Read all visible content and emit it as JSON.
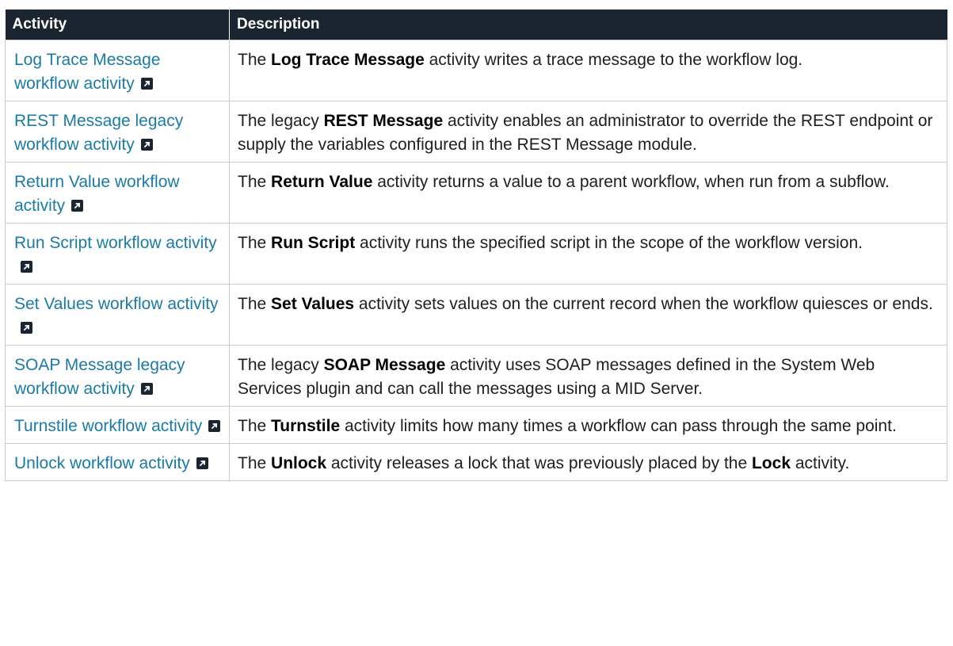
{
  "table": {
    "headers": {
      "activity": "Activity",
      "description": "Description"
    },
    "rows": [
      {
        "link": "Log Trace Message workflow activity",
        "icon": "external-link-icon",
        "desc": [
          {
            "t": "The "
          },
          {
            "b": "Log Trace Message"
          },
          {
            "t": " activity writes a trace message to the workflow log."
          }
        ]
      },
      {
        "link": "REST Message legacy workflow activity",
        "icon": "external-link-icon",
        "desc": [
          {
            "t": "The legacy "
          },
          {
            "b": "REST Message"
          },
          {
            "t": " activity enables an administrator to override the REST endpoint or supply the variables configured in the REST Message module."
          }
        ]
      },
      {
        "link": "Return Value workflow activity",
        "icon": "external-link-icon",
        "desc": [
          {
            "t": "The "
          },
          {
            "b": "Return Value"
          },
          {
            "t": " activity returns a value to a parent workflow, when run from a subflow."
          }
        ]
      },
      {
        "link": "Run Script workflow activity",
        "icon": "external-link-icon",
        "desc": [
          {
            "t": "The "
          },
          {
            "b": "Run Script"
          },
          {
            "t": " activity runs the specified script in the scope of the workflow version."
          }
        ]
      },
      {
        "link": "Set Values workflow activity",
        "icon": "external-link-icon",
        "desc": [
          {
            "t": "The "
          },
          {
            "b": "Set Values"
          },
          {
            "t": " activity sets values on the current record when the workflow quiesces or ends."
          }
        ]
      },
      {
        "link": "SOAP Message legacy workflow activity",
        "icon": "external-link-icon",
        "desc": [
          {
            "t": "The legacy "
          },
          {
            "b": "SOAP Message"
          },
          {
            "t": " activity uses SOAP messages defined in the System Web Services plugin and can call the messages using a MID Server."
          }
        ]
      },
      {
        "link": "Turnstile workflow activity",
        "icon": "external-link-icon",
        "desc": [
          {
            "t": "The "
          },
          {
            "b": "Turnstile"
          },
          {
            "t": " activity limits how many times a workflow can pass through the same point."
          }
        ]
      },
      {
        "link": "Unlock workflow activity",
        "icon": "external-link-icon",
        "desc": [
          {
            "t": "The "
          },
          {
            "b": "Unlock"
          },
          {
            "t": " activity releases a lock that was previously placed by the "
          },
          {
            "b": "Lock"
          },
          {
            "t": " activity."
          }
        ]
      }
    ]
  },
  "colors": {
    "header_bg": "#1b2531",
    "link": "#1a7aa8",
    "border": "#c8ccd0"
  }
}
